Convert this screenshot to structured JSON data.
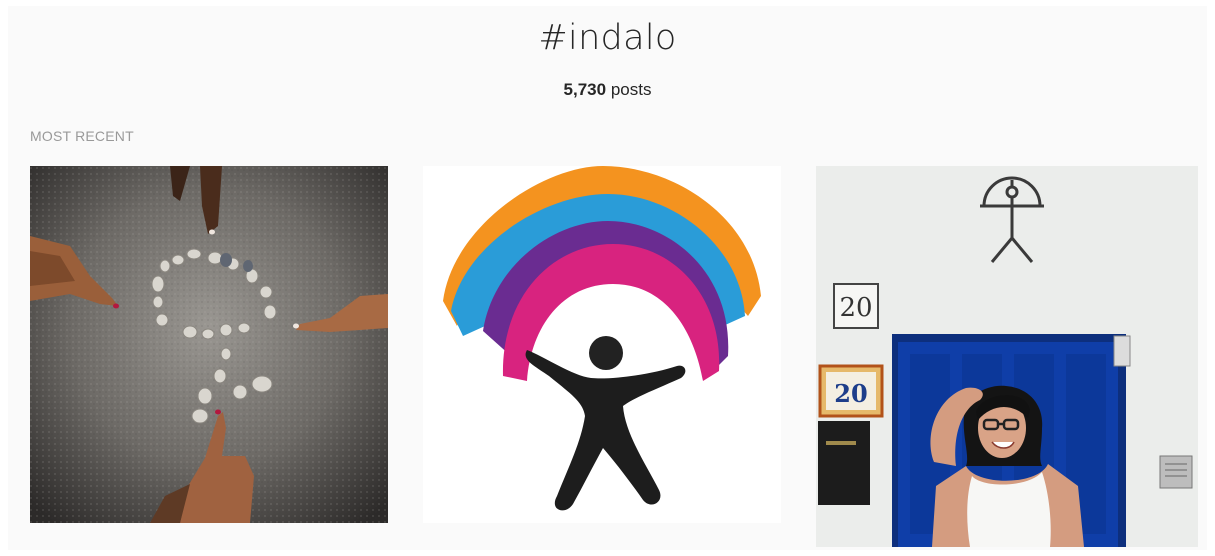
{
  "header": {
    "hashtag": "#indalo",
    "post_count": "5,730",
    "post_count_suffix": "posts"
  },
  "section": {
    "label": "MOST RECENT"
  },
  "posts": [
    {
      "subject": "hands pointing at indalo shape made of stones in sand"
    },
    {
      "subject": "colorful indalo logo figure holding a rainbow arc"
    },
    {
      "subject": "woman in front of blue door with indalo symbol above",
      "sign_text_1": "20",
      "sign_text_2": "20"
    }
  ],
  "colors": {
    "background": "#fafafa",
    "text": "#262626",
    "muted": "#999999",
    "door_blue": "#0f3ea8",
    "logo_orange": "#f4931f",
    "logo_blue": "#2a9cd8",
    "logo_purple": "#6a2c91",
    "logo_magenta": "#d8237f"
  }
}
